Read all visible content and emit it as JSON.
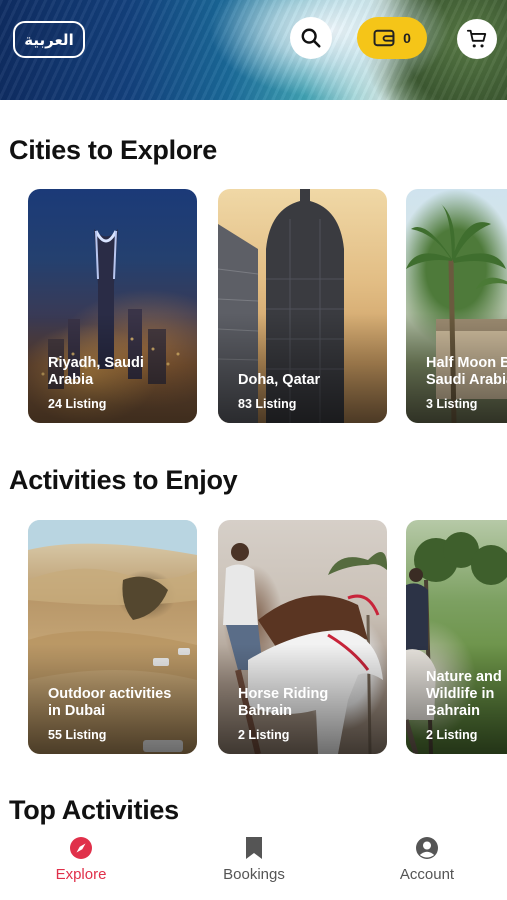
{
  "header": {
    "language_label": "العربية",
    "wallet_count": "0"
  },
  "cities": {
    "title": "Cities to Explore",
    "items": [
      {
        "name": "Riyadh, Saudi\nArabia",
        "listing": "24 Listing"
      },
      {
        "name": "Doha, Qatar",
        "listing": "83 Listing"
      },
      {
        "name": "Half Moon Bay,\nSaudi Arabia",
        "listing": "3 Listing"
      }
    ]
  },
  "activities": {
    "title": "Activities to Enjoy",
    "items": [
      {
        "name": "Outdoor activities\nin Dubai",
        "listing": "55 Listing"
      },
      {
        "name": "Horse Riding\nBahrain",
        "listing": "2 Listing"
      },
      {
        "name": "Nature and\nWildlife in\nBahrain",
        "listing": "2 Listing"
      }
    ]
  },
  "top_activities": {
    "title": "Top Activities"
  },
  "nav": {
    "items": [
      {
        "label": "Explore",
        "icon": "compass-icon",
        "active": true
      },
      {
        "label": "Bookings",
        "icon": "bookmark-icon",
        "active": false
      },
      {
        "label": "Account",
        "icon": "user-circle-icon",
        "active": false
      }
    ],
    "active_color": "#e0304a",
    "inactive_color": "#555555"
  },
  "colors": {
    "wallet_yellow": "#f5c518"
  }
}
